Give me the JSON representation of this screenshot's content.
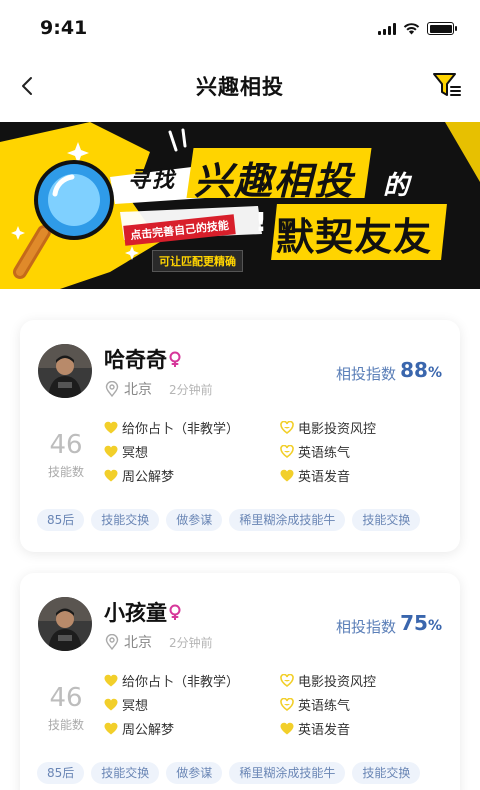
{
  "status_bar": {
    "time": "9:41"
  },
  "nav": {
    "title": "兴趣相投",
    "back_icon": "chevron-left-icon",
    "filter_icon": "filter-icon"
  },
  "banner": {
    "title_left": "寻找",
    "title_main": "兴趣相投",
    "title_suffix": "的",
    "subtitle": "默契友友",
    "tag_complete": "点击完善自己的技能",
    "tag_match": "可让匹配更精确",
    "accent_color": "#ffd400"
  },
  "colors": {
    "match_blue": "#3a66ad",
    "heart_yellow": "#f2cf2a",
    "tag_bg": "#eef3fb",
    "gender_pink": "#d6379a"
  },
  "cards": [
    {
      "name": "哈奇奇",
      "location": "北京",
      "time": "2分钟前",
      "match_label": "相投指数",
      "match_value": "88",
      "match_unit": "%",
      "skill_count": "46",
      "skill_count_label": "技能数",
      "skills": [
        "给你占卜（非教学）",
        "电影投资风控",
        "冥想",
        "英语练气",
        "周公解梦",
        "英语发音"
      ],
      "tags": [
        "85后",
        "技能交换",
        "做参谋",
        "稀里糊涂成技能牛",
        "技能交换"
      ]
    },
    {
      "name": "小孩童",
      "location": "北京",
      "time": "2分钟前",
      "match_label": "相投指数",
      "match_value": "75",
      "match_unit": "%",
      "skill_count": "46",
      "skill_count_label": "技能数",
      "skills": [
        "给你占卜（非教学）",
        "电影投资风控",
        "冥想",
        "英语练气",
        "周公解梦",
        "英语发音"
      ],
      "tags": [
        "85后",
        "技能交换",
        "做参谋",
        "稀里糊涂成技能牛",
        "技能交换"
      ]
    }
  ]
}
